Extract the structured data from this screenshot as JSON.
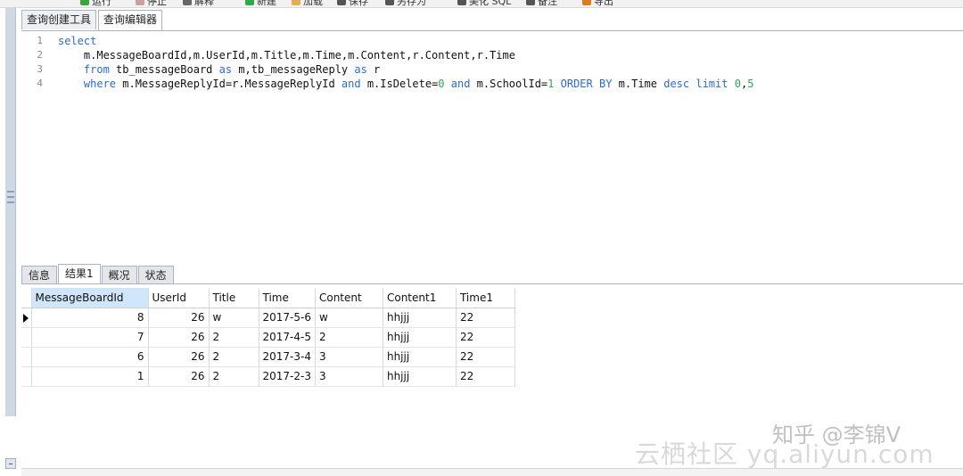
{
  "toolbar": {
    "items": [
      {
        "label": "运行",
        "icon": "play-icon",
        "color": "#3aa53a"
      },
      {
        "label": "停止",
        "icon": "stop-icon",
        "color": "#c9a0a0"
      },
      {
        "label": "解释",
        "icon": "explain-icon",
        "color": "#666666"
      },
      {
        "label": "新建",
        "icon": "new-icon",
        "color": "#2fa84b"
      },
      {
        "label": "加载",
        "icon": "folder-icon",
        "color": "#e0b050"
      },
      {
        "label": "保存",
        "icon": "save-icon",
        "color": "#555555"
      },
      {
        "label": "另存为",
        "icon": "save-as-icon",
        "color": "#555555"
      },
      {
        "label": "美化 SQL",
        "icon": "beautify-icon",
        "color": "#555555"
      },
      {
        "label": "备注",
        "icon": "note-icon",
        "color": "#555555"
      },
      {
        "label": "导出",
        "icon": "export-icon",
        "color": "#e07a20"
      }
    ]
  },
  "tabs": [
    {
      "label": "查询创建工具",
      "active": false
    },
    {
      "label": "查询编辑器",
      "active": true
    }
  ],
  "editor": {
    "lines": [
      {
        "num": "1",
        "parts": [
          {
            "t": "select",
            "c": "kw"
          }
        ]
      },
      {
        "num": "2",
        "parts": [
          {
            "t": "    m.MessageBoardId,m.UserId,m.Title,m.Time,m.Content,r.Content,r.Time",
            "c": ""
          }
        ]
      },
      {
        "num": "3",
        "parts": [
          {
            "t": "    ",
            "c": ""
          },
          {
            "t": "from",
            "c": "kw"
          },
          {
            "t": " tb_messageBoard ",
            "c": ""
          },
          {
            "t": "as",
            "c": "kw"
          },
          {
            "t": " m,tb_messageReply ",
            "c": ""
          },
          {
            "t": "as",
            "c": "kw"
          },
          {
            "t": " r",
            "c": ""
          }
        ]
      },
      {
        "num": "4",
        "parts": [
          {
            "t": "    ",
            "c": ""
          },
          {
            "t": "where",
            "c": "kw"
          },
          {
            "t": " m.MessageReplyId=r.MessageReplyId ",
            "c": ""
          },
          {
            "t": "and",
            "c": "kw"
          },
          {
            "t": " m.IsDelete=",
            "c": ""
          },
          {
            "t": "0",
            "c": "num"
          },
          {
            "t": " ",
            "c": ""
          },
          {
            "t": "and",
            "c": "kw"
          },
          {
            "t": " m.SchoolId=",
            "c": ""
          },
          {
            "t": "1",
            "c": "num"
          },
          {
            "t": " ",
            "c": ""
          },
          {
            "t": "ORDER BY",
            "c": "kw"
          },
          {
            "t": " m.Time ",
            "c": ""
          },
          {
            "t": "desc",
            "c": "kw"
          },
          {
            "t": " ",
            "c": ""
          },
          {
            "t": "limit",
            "c": "kw"
          },
          {
            "t": " ",
            "c": ""
          },
          {
            "t": "0",
            "c": "num"
          },
          {
            "t": ",",
            "c": ""
          },
          {
            "t": "5",
            "c": "num"
          }
        ]
      }
    ]
  },
  "result_tabs": [
    {
      "label": "信息",
      "active": false
    },
    {
      "label": "结果1",
      "active": true
    },
    {
      "label": "概况",
      "active": false
    },
    {
      "label": "状态",
      "active": false
    }
  ],
  "grid": {
    "columns": [
      "MessageBoardId",
      "UserId",
      "Title",
      "Time",
      "Content",
      "Content1",
      "Time1"
    ],
    "rows": [
      [
        "8",
        "26",
        "w",
        "2017-5-6",
        "w",
        "hhjjj",
        "22"
      ],
      [
        "7",
        "26",
        "2",
        "2017-4-5",
        "2",
        "hhjjj",
        "22"
      ],
      [
        "6",
        "26",
        "2",
        "2017-3-4",
        "3",
        "hhjjj",
        "22"
      ],
      [
        "1",
        "26",
        "2",
        "2017-2-3",
        "3",
        "hhjjj",
        "22"
      ]
    ]
  },
  "watermark": {
    "zhihu": "知乎 @李锦V",
    "yunqi": "云栖社区 yq.aliyun.com"
  }
}
